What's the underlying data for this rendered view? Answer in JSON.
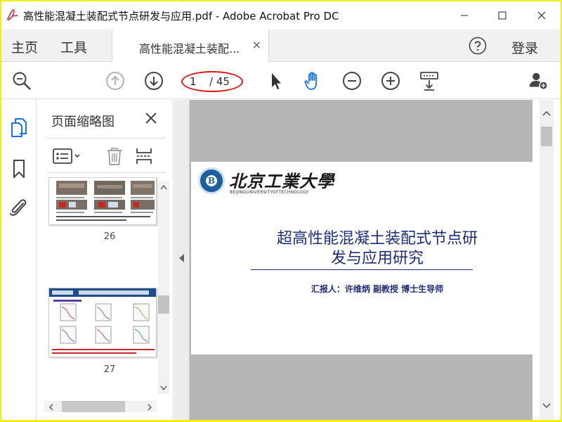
{
  "window": {
    "title": "高性能混凝土装配式节点研发与应用.pdf - Adobe Acrobat Pro DC",
    "app_icon": "acrobat-icon",
    "controls": [
      "minimize-icon",
      "maximize-icon",
      "close-icon"
    ]
  },
  "menu": {
    "home": "主页",
    "tools": "工具",
    "doc_tab_label": "高性能混凝土装配...",
    "doc_tab_close": "×",
    "help_icon": "help-icon",
    "login": "登录"
  },
  "toolbar": {
    "search_icon": "zoom-search-icon",
    "prev_page_icon": "page-up-icon",
    "next_page_icon": "page-down-icon",
    "current_page": "1",
    "page_total": "/ 45",
    "select_tool_icon": "pointer-icon",
    "hand_tool_icon": "hand-icon",
    "zoom_out_icon": "zoom-out-icon",
    "zoom_in_icon": "zoom-in-icon",
    "display_options_icon": "display-options-icon",
    "share_icon": "add-user-icon",
    "accent_color": "#1473e6",
    "annotation_color": "#e01818"
  },
  "rail": {
    "items": [
      "page-thumbnails-icon",
      "bookmark-icon",
      "attachment-icon"
    ]
  },
  "thumbnails_panel": {
    "title": "页面缩略图",
    "close": "×",
    "tools": [
      "options-menu-icon",
      "delete-icon",
      "insert-page-icon"
    ],
    "pages": [
      {
        "number": "26"
      },
      {
        "number": "27"
      }
    ]
  },
  "document": {
    "university_cn": "北京工業大學",
    "university_en": "BEIJINGUNIVERSITYOFTECHNOLOGY",
    "title_line1": "超高性能混凝土装配式节点研",
    "title_line2": "发与应用研究",
    "reporter": "汇报人：许维炳 副教授 博士生导师",
    "title_color": "#1e2f7a"
  }
}
